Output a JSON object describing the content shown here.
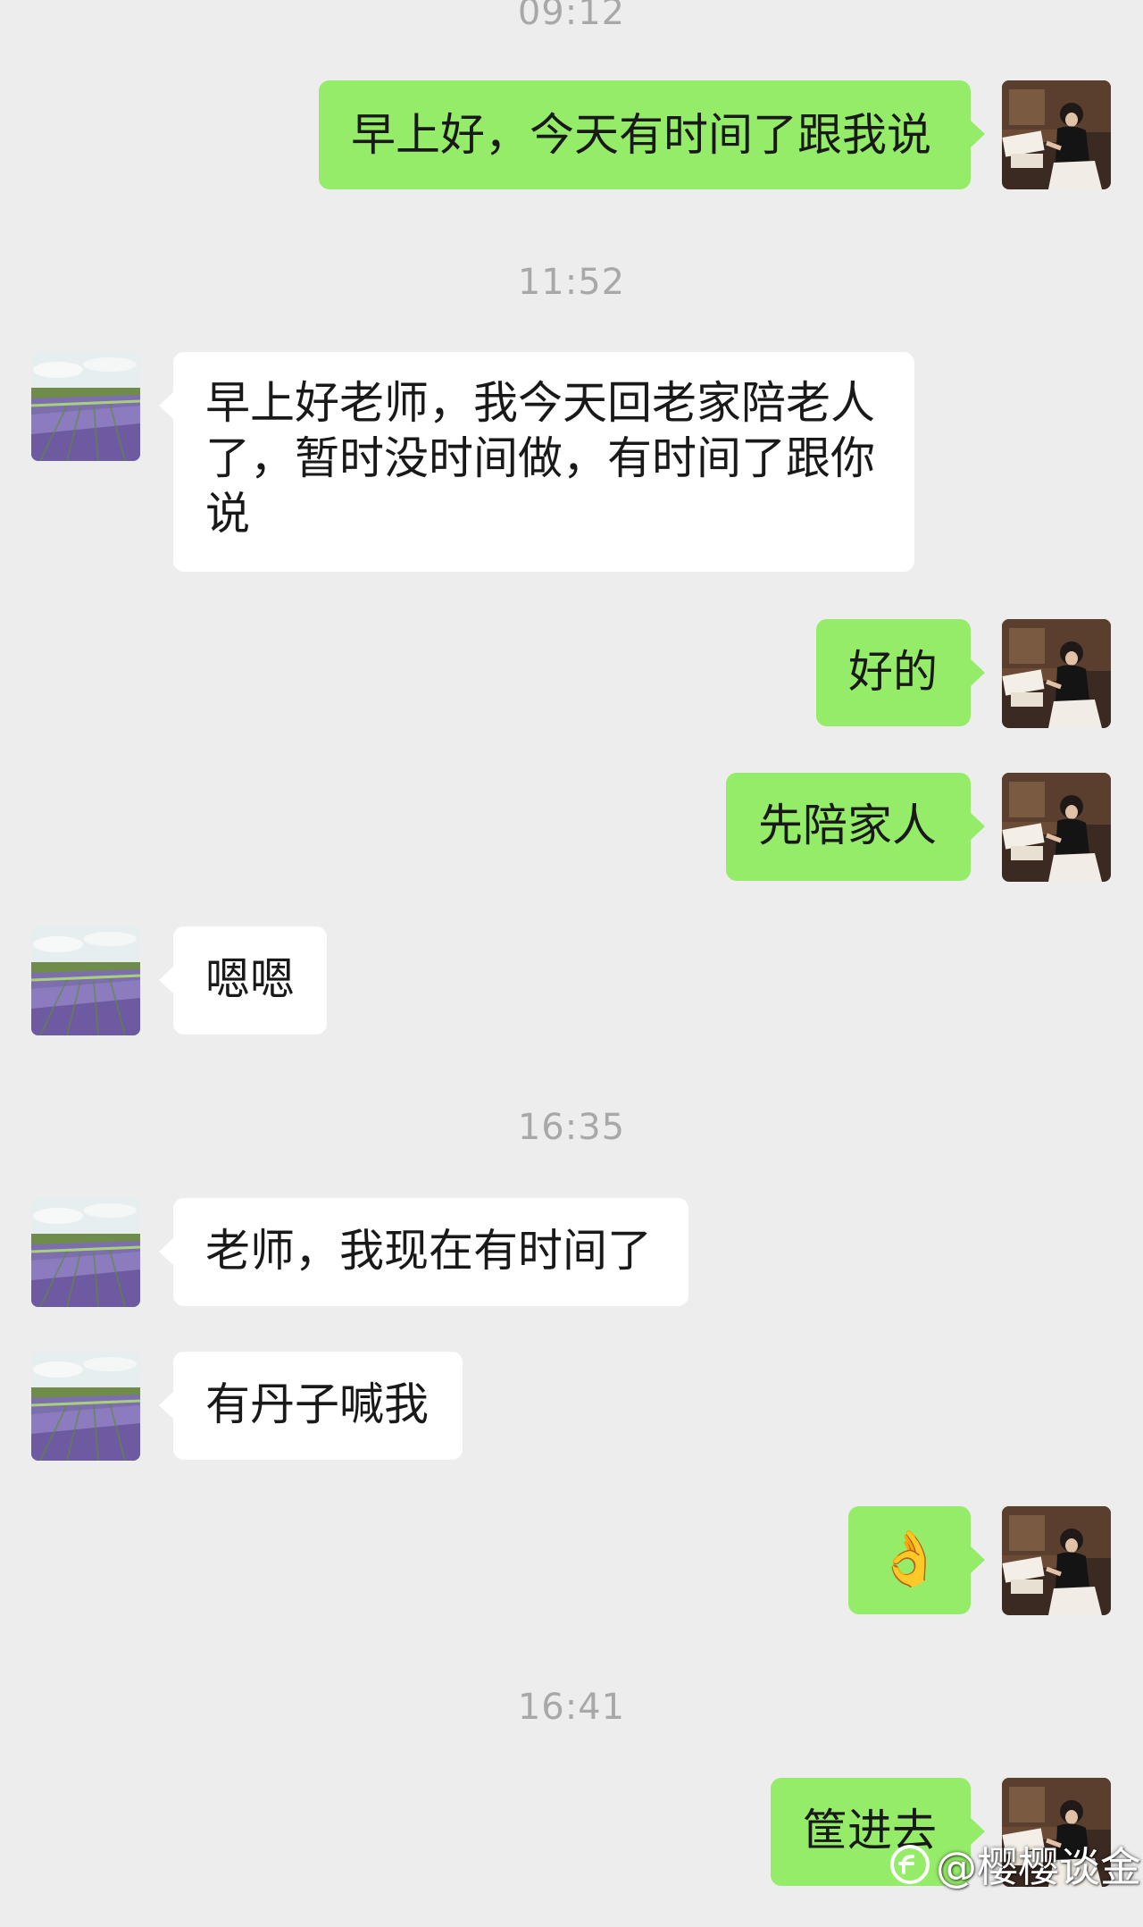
{
  "timestamps": [
    "09:12",
    "11:52",
    "16:35",
    "16:41"
  ],
  "messages": [
    {
      "id": "m1",
      "direction": "out",
      "text": "早上好，今天有时间了跟我说"
    },
    {
      "id": "m2",
      "direction": "in",
      "text": "早上好老师，我今天回老家陪老人了，暂时没时间做，有时间了跟你说"
    },
    {
      "id": "m3",
      "direction": "out",
      "text": "好的"
    },
    {
      "id": "m4",
      "direction": "out",
      "text": "先陪家人"
    },
    {
      "id": "m5",
      "direction": "in",
      "text": "嗯嗯"
    },
    {
      "id": "m6",
      "direction": "in",
      "text": "老师，我现在有时间了"
    },
    {
      "id": "m7",
      "direction": "in",
      "text": "有丹子喊我"
    },
    {
      "id": "m8",
      "direction": "out",
      "text": "👌"
    },
    {
      "id": "m9",
      "direction": "out",
      "text": "筐进去"
    }
  ],
  "watermark": {
    "text": "@樱樱谈金"
  },
  "colors": {
    "background": "#ededed",
    "incoming_bubble": "#ffffff",
    "outgoing_bubble": "#95ec69",
    "timestamp": "#a8a8a8"
  },
  "avatars": {
    "contact": "lavender-field-icon",
    "self": "person-reading-icon"
  }
}
